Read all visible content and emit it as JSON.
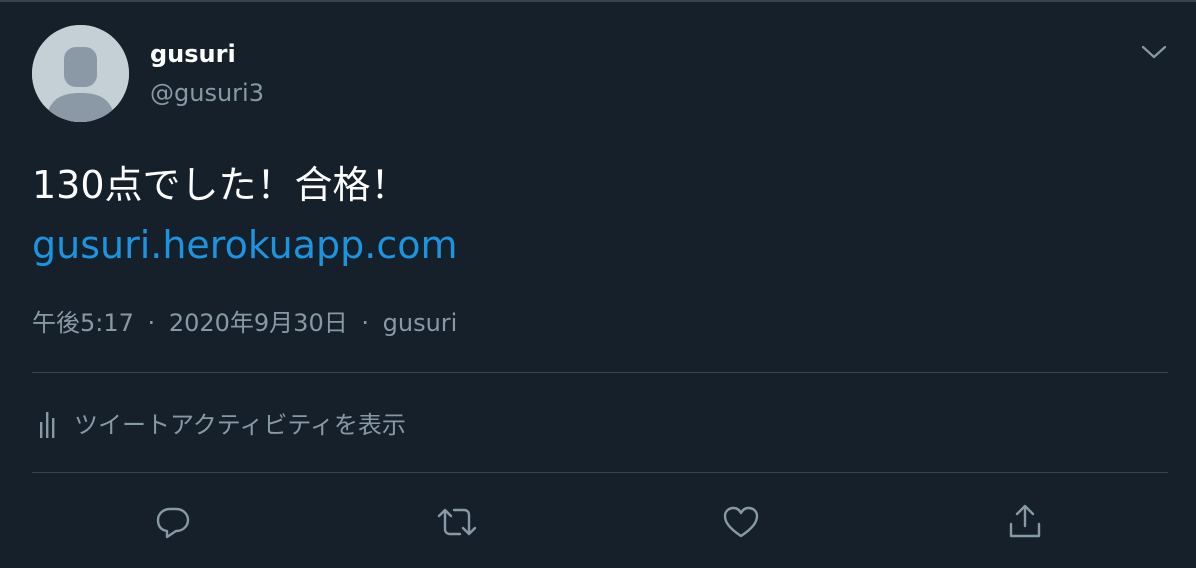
{
  "user": {
    "display_name": "gusuri",
    "handle": "@gusuri3",
    "avatar_icon": "default-avatar-icon"
  },
  "menu_icon": "chevron-down-icon",
  "tweet": {
    "text": "130点でした！合格！",
    "link": "gusuri.herokuapp.com"
  },
  "meta": {
    "time": "午後5:17",
    "separator": "·",
    "date": "2020年9月30日",
    "source": "gusuri"
  },
  "activity": {
    "icon": "analytics-icon",
    "label": "ツイートアクティビティを表示"
  },
  "actions": [
    {
      "name": "reply",
      "icon": "reply-icon"
    },
    {
      "name": "retweet",
      "icon": "retweet-icon"
    },
    {
      "name": "like",
      "icon": "like-icon"
    },
    {
      "name": "share",
      "icon": "share-icon"
    }
  ],
  "colors": {
    "background": "#15202b",
    "primary_text": "#ffffff",
    "secondary_text": "#8899a6",
    "link": "#1b95e0",
    "border": "#38444d",
    "avatar_bg": "#c4cfd6",
    "avatar_fg": "#aab8c2"
  }
}
